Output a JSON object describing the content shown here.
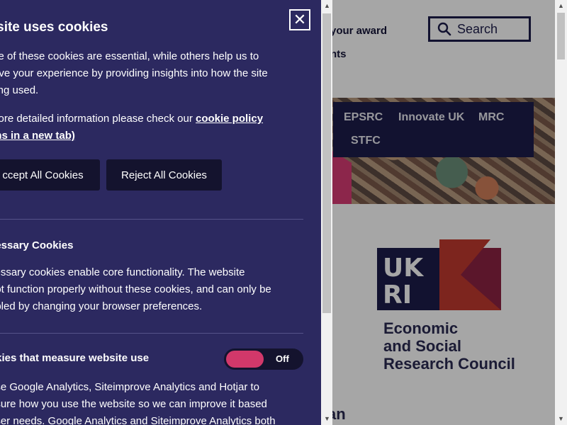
{
  "site": {
    "nav_award": "your award",
    "nav_events": "nts",
    "search_placeholder": "Search",
    "councils": [
      "EPSRC",
      "Innovate UK",
      "MRC",
      "STFC"
    ],
    "logo_lines": [
      "Economic",
      "and Social",
      "Research Council"
    ],
    "bottom_heading": "an"
  },
  "cookie_panel": {
    "title": "is site uses cookies",
    "close_label": "✕",
    "intro_lines": [
      "me of these cookies are essential, while others help us to",
      "rove your experience by providing insights into how the site",
      "eing used."
    ],
    "policy_prefix": "more detailed information please check our ",
    "policy_link_1": "cookie policy",
    "policy_link_2": "ens in a new tab)",
    "accept_label": "ccept All Cookies",
    "reject_label": "Reject All Cookies",
    "necessary": {
      "title": "cessary Cookies",
      "lines": [
        "cessary cookies enable core functionality. The website",
        "not function properly without these cookies, and can only be",
        "abled by changing your browser preferences."
      ]
    },
    "analytics": {
      "title": "okies that measure website use",
      "toggle_state": "Off",
      "lines": [
        "use Google Analytics, Siteimprove Analytics and Hotjar to",
        "asure how you use the website so we can improve it based",
        "user needs. Google Analytics and Siteimprove Analytics both"
      ]
    }
  },
  "colors": {
    "panel_bg": "#2c2960",
    "button_bg": "#14132e",
    "toggle_knob": "#d2386a",
    "brand_navy": "#1d1d4a",
    "ukri_red": "#c0392f",
    "ukri_maroon": "#8c2343"
  }
}
